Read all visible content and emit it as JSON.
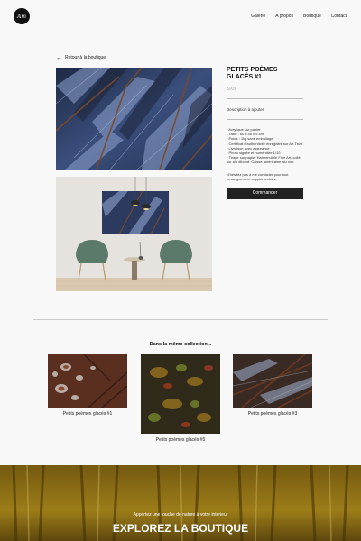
{
  "header": {
    "logo_text": "Am",
    "nav": [
      "Galerie",
      "A propos",
      "Boutique",
      "Contact"
    ]
  },
  "back_link": "Retour à la boutique",
  "product": {
    "title": "PETITS POÈMES GLACÉS #1",
    "price": "500€",
    "desc_label": "Description à ajouter",
    "details": [
      "• Acrylique sur papier",
      "• Taille : 60 x 45 x 5 cm",
      "• Poids : 1kg sans emballage",
      "• Certificat d'authenticité enregistré sur Art Trust",
      "• Livraison avec assurance",
      "• Photo signée et numérotée 1/10",
      "• Tirage sur papier Hahnemühle Fine Art, collé sur alu dibond. Caisse américaine alu noir."
    ],
    "contact_note": "N'hésitez pas à me contacter pour tout renseignement supplémentaire.",
    "cta": "Commander"
  },
  "collection": {
    "heading": "Dans la même collection...",
    "items": [
      {
        "label": "Petits poèmes glacés #1"
      },
      {
        "label": "Petits poèmes glacés #5"
      },
      {
        "label": "Petits poèmes glacés #3"
      }
    ]
  },
  "banner": {
    "subtitle": "Apportez une touche de nature à votre intérieur",
    "title": "EXPLOREZ LA BOUTIQUE"
  }
}
